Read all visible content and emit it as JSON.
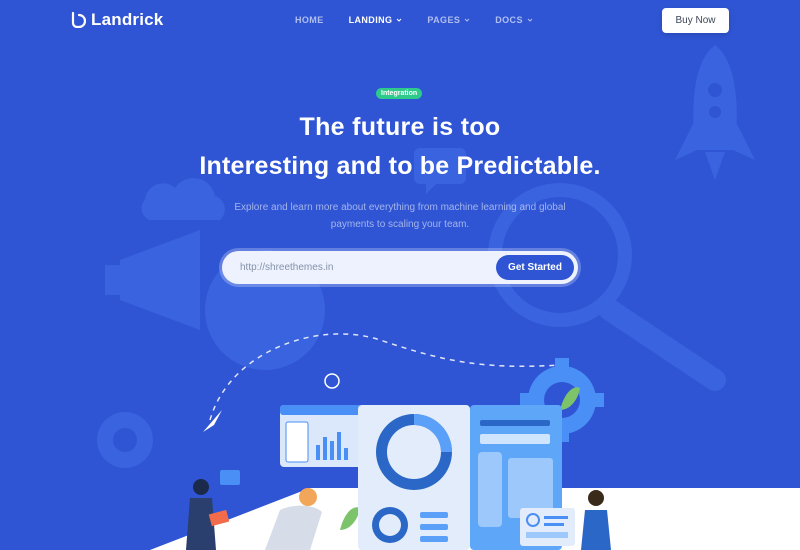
{
  "brand": {
    "name": "Landrick",
    "icon": "landrick-logo-icon"
  },
  "nav": {
    "items": [
      {
        "label": "HOME",
        "active": false,
        "dropdown": false
      },
      {
        "label": "LANDING",
        "active": true,
        "dropdown": true
      },
      {
        "label": "PAGES",
        "active": false,
        "dropdown": true
      },
      {
        "label": "DOCS",
        "active": false,
        "dropdown": true
      }
    ],
    "buy_label": "Buy Now"
  },
  "hero": {
    "badge": "Integration",
    "title_line1": "The future is too",
    "title_line2_bold_a": "Interesting",
    "title_line2_mid": " and to be ",
    "title_line2_bold_b": "Predictable.",
    "subtitle_line1": "Explore and learn more about everything from machine learning and global",
    "subtitle_line2": "payments to scaling your team.",
    "search_placeholder": "http://shreethemes.in",
    "cta_label": "Get Started"
  },
  "colors": {
    "background": "#2f55d4",
    "accent_green": "#2eca8b",
    "button_blue": "#2f55d4"
  }
}
